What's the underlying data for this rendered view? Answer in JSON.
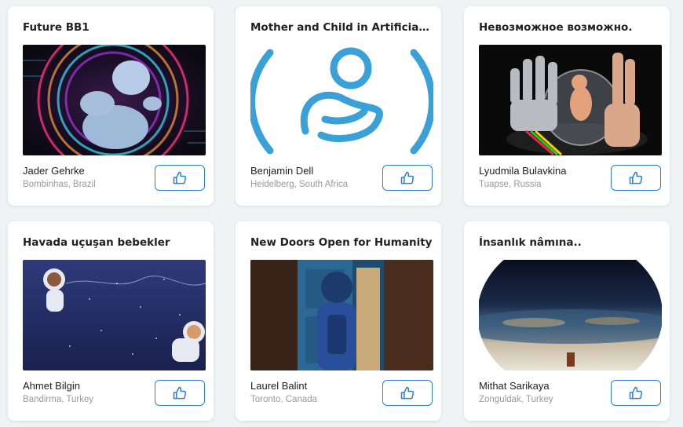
{
  "colors": {
    "accent": "#2a7fd4",
    "background": "#f1f2f4",
    "card": "#ffffff"
  },
  "cards": [
    {
      "title": "Future BB1",
      "author": "Jader Gehrke",
      "location": "Bombinhas, Brazil",
      "icon": "thumbs-up-icon"
    },
    {
      "title": "Mother and Child in Artificial Gra...",
      "author": "Benjamin Dell",
      "location": "Heidelberg, South Africa",
      "icon": "thumbs-up-icon"
    },
    {
      "title": "Невозможное возможно.",
      "author": "Lyudmila Bulavkina",
      "location": "Tuapse, Russia",
      "icon": "thumbs-up-icon"
    },
    {
      "title": "Havada uçuşan bebekler",
      "author": "Ahmet Bilgin",
      "location": "Bandirma, Turkey",
      "icon": "thumbs-up-icon"
    },
    {
      "title": "New Doors Open for Humanity",
      "author": "Laurel Balint",
      "location": "Toronto, Canada",
      "icon": "thumbs-up-icon"
    },
    {
      "title": "İnsanlık nâmına..",
      "author": "Mithat Sarikaya",
      "location": "Zonguldak, Turkey",
      "icon": "thumbs-up-icon"
    }
  ]
}
